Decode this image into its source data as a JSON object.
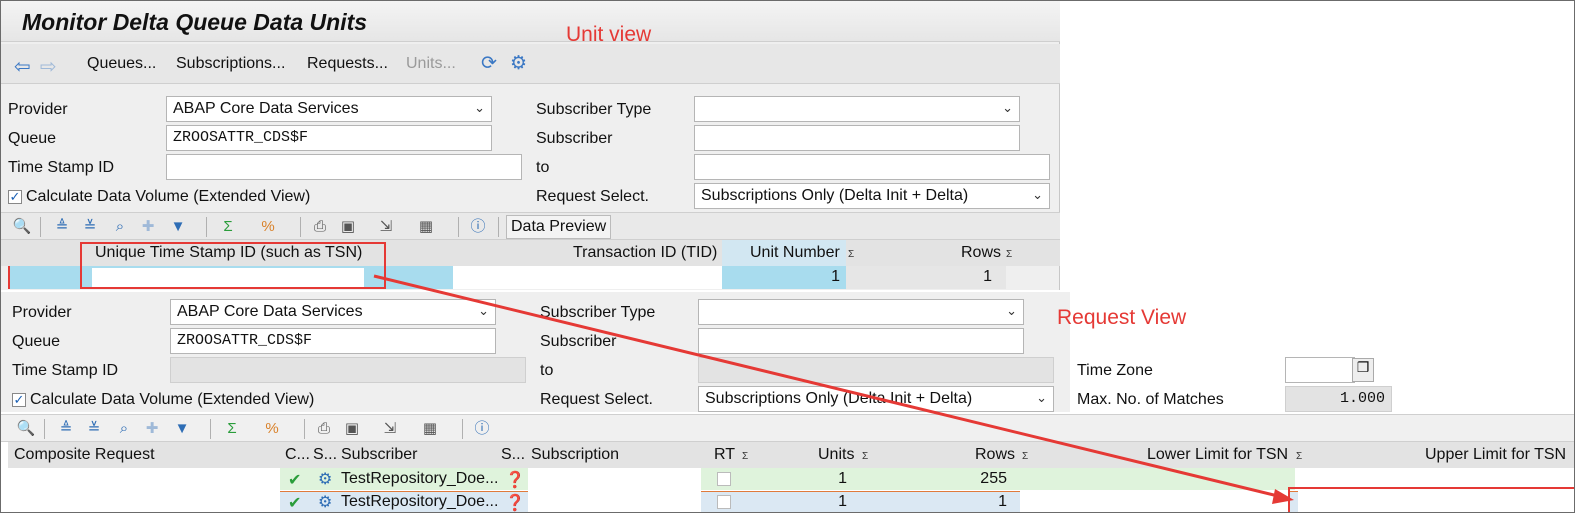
{
  "app": {
    "title": "Monitor Delta Queue Data Units"
  },
  "annotations": {
    "unit_view": "Unit view",
    "request_view": "Request View"
  },
  "toolbar": {
    "queues": "Queues...",
    "subscriptions": "Subscriptions...",
    "requests": "Requests...",
    "units": "Units..."
  },
  "unit_view": {
    "provider_label": "Provider",
    "provider_value": "ABAP Core Data Services",
    "queue_label": "Queue",
    "queue_value": "ZROOSATTR_CDS$F",
    "timestamp_label": "Time Stamp ID",
    "calc_label": "Calculate Data Volume (Extended View)",
    "subscriber_type_label": "Subscriber Type",
    "subscriber_label": "Subscriber",
    "to_label": "to",
    "request_select_label": "Request Select.",
    "request_select_value": "Subscriptions Only (Delta Init + Delta)",
    "data_preview": "Data Preview",
    "columns": {
      "tsid": "Unique Time Stamp ID (such as TSN)",
      "tid": "Transaction ID (TID)",
      "unit_number": "Unit Number",
      "rows": "Rows"
    },
    "row": {
      "unit_number": "1",
      "rows": "1"
    }
  },
  "request_view": {
    "provider_label": "Provider",
    "provider_value": "ABAP Core Data Services",
    "queue_label": "Queue",
    "queue_value": "ZROOSATTR_CDS$F",
    "timestamp_label": "Time Stamp ID",
    "calc_label": "Calculate Data Volume (Extended View)",
    "subscriber_type_label": "Subscriber Type",
    "subscriber_label": "Subscriber",
    "to_label": "to",
    "request_select_label": "Request Select.",
    "request_select_value": "Subscriptions Only (Delta Init + Delta)",
    "time_zone_label": "Time Zone",
    "max_matches_label": "Max. No. of Matches",
    "max_matches_value": "1.000",
    "columns": {
      "composite": "Composite Request",
      "c": "C...",
      "s1": "S...",
      "subscriber": "Subscriber",
      "s2": "S...",
      "subscription": "Subscription",
      "rt": "RT",
      "units": "Units",
      "rows": "Rows",
      "lower": "Lower Limit for TSN",
      "upper": "Upper Limit for TSN"
    },
    "rows": [
      {
        "subscriber": "TestRepository_Doe...",
        "units": "1",
        "rows": "255"
      },
      {
        "subscriber": "TestRepository_Doe...",
        "units": "1",
        "rows": "1"
      }
    ]
  },
  "icons": [
    "back-arrow-icon",
    "forward-arrow-icon",
    "refresh-icon",
    "settings-icon",
    "details-icon",
    "sort-asc-icon",
    "sort-desc-icon",
    "find-icon",
    "find-next-icon",
    "filter-icon",
    "sum-icon",
    "subtotal-icon",
    "print-icon",
    "view-icon",
    "export-icon",
    "layout-icon",
    "info-icon",
    "checkmark-icon",
    "subscriber-icon",
    "status-icon"
  ],
  "colors": {
    "annotation": "#e53935",
    "selected_cell": "#a8dcee",
    "row_green": "#dff3dc",
    "row_blue": "#dbe8f3"
  }
}
